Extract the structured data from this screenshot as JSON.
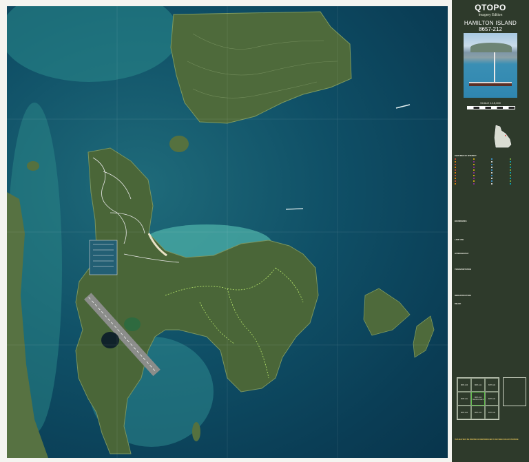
{
  "header": {
    "brand": "QTOPO",
    "subtitle": "Imagery Edition",
    "map_name": "HAMILTON ISLAND",
    "map_number": "8657-212",
    "scale": "SCALE 1:15,000"
  },
  "colors": {
    "panel_bg": "#2e3a2b",
    "sea_deep": "#0a3d55",
    "sea_shallow": "#3fa9a8",
    "land": "#4f6b3c",
    "track": "#b8e86b",
    "road": "#e8e8e8"
  },
  "legend": {
    "built_heading": "FEATURES OF INTEREST",
    "boundaries_heading": "BOUNDARIES",
    "land_use_heading": "LAND USE",
    "hydrography_heading": "HYDROGRAPHY",
    "transport_heading": "TRANSPORTATION",
    "infrastructure_heading": "INFRASTRUCTURE",
    "relief_heading": "RELIEF"
  },
  "index": {
    "cells": [
      {
        "num": "8657-133",
        "name": ""
      },
      {
        "num": "8657-141",
        "name": ""
      },
      {
        "num": "8757-334",
        "name": ""
      },
      {
        "num": "8657-211",
        "name": ""
      },
      {
        "num": "8657-212",
        "name": "Hamilton Island"
      },
      {
        "num": "8757-342",
        "name": ""
      },
      {
        "num": "8657-244",
        "name": ""
      },
      {
        "num": "8657-243",
        "name": ""
      },
      {
        "num": "8757-343",
        "name": ""
      }
    ]
  },
  "footer": {
    "warning": "THIS MAP MAY BE PRINTED OR REPRODUCED BY ANYONE FOR ANY PURPOSE"
  }
}
